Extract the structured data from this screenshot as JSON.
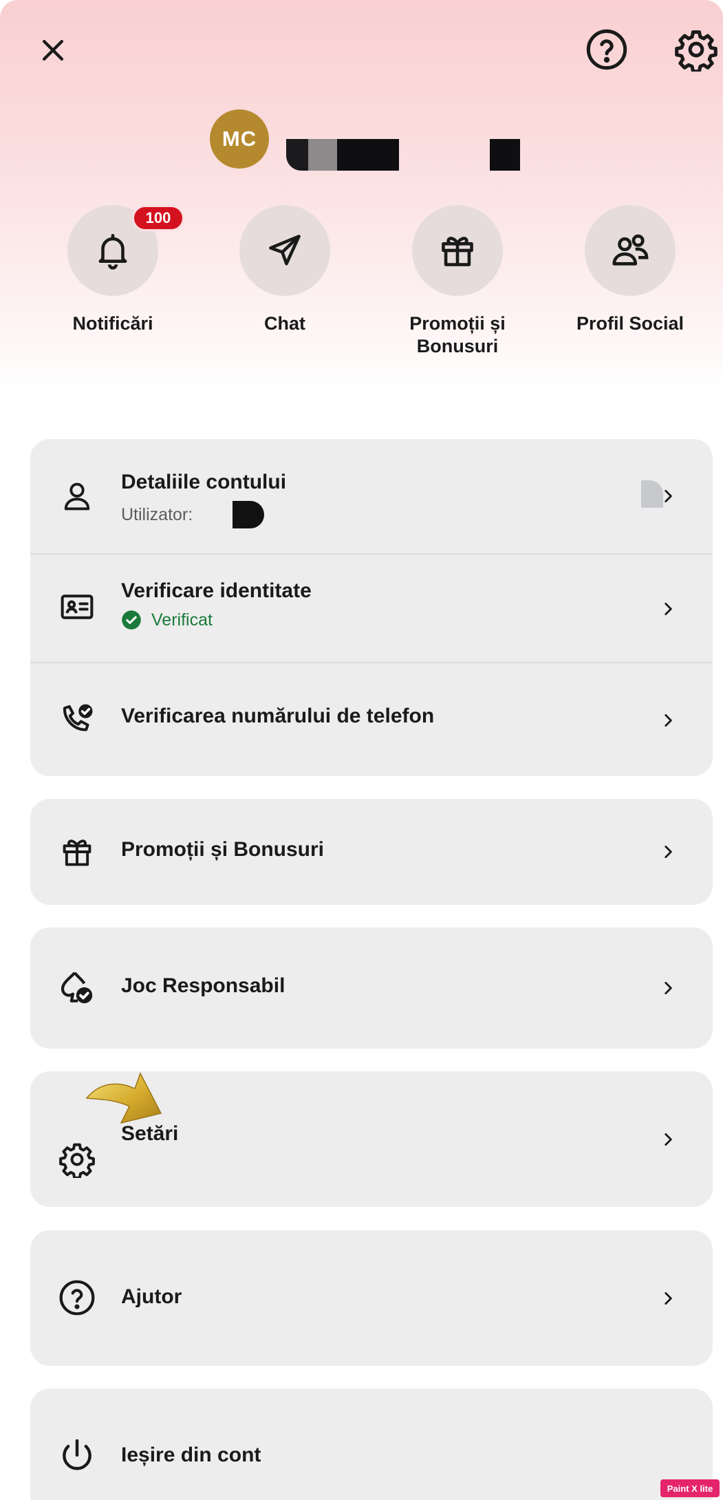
{
  "header": {
    "close_icon": "close-icon",
    "help_icon": "help-circle-icon",
    "settings_icon": "gear-icon"
  },
  "profile": {
    "initials": "MC",
    "avatar_color": "#b58a2e"
  },
  "quick_actions": [
    {
      "label": "Notificări",
      "icon": "bell-icon",
      "badge": "100"
    },
    {
      "label": "Chat",
      "icon": "send-icon"
    },
    {
      "label": "Promoții și Bonusuri",
      "icon": "gift-icon"
    },
    {
      "label": "Profil Social",
      "icon": "users-icon"
    }
  ],
  "menu": {
    "account": {
      "title": "Detaliile contului",
      "subtitle": "Utilizator:"
    },
    "identity": {
      "title": "Verificare identitate",
      "status": "Verificat",
      "status_color": "#1b7a3a"
    },
    "phone": {
      "title": "Verificarea numărului de telefon"
    },
    "promotions": {
      "title": "Promoții și Bonusuri"
    },
    "responsible": {
      "title": "Joc Responsabil"
    },
    "settings": {
      "title": "Setări"
    },
    "help": {
      "title": "Ajutor"
    },
    "logout": {
      "title": "Ieșire din cont"
    }
  },
  "watermark": "Paint X lite",
  "colors": {
    "badge": "#d4111e",
    "card_bg": "#ededee",
    "header_gradient_top": "#f9cfd1"
  }
}
